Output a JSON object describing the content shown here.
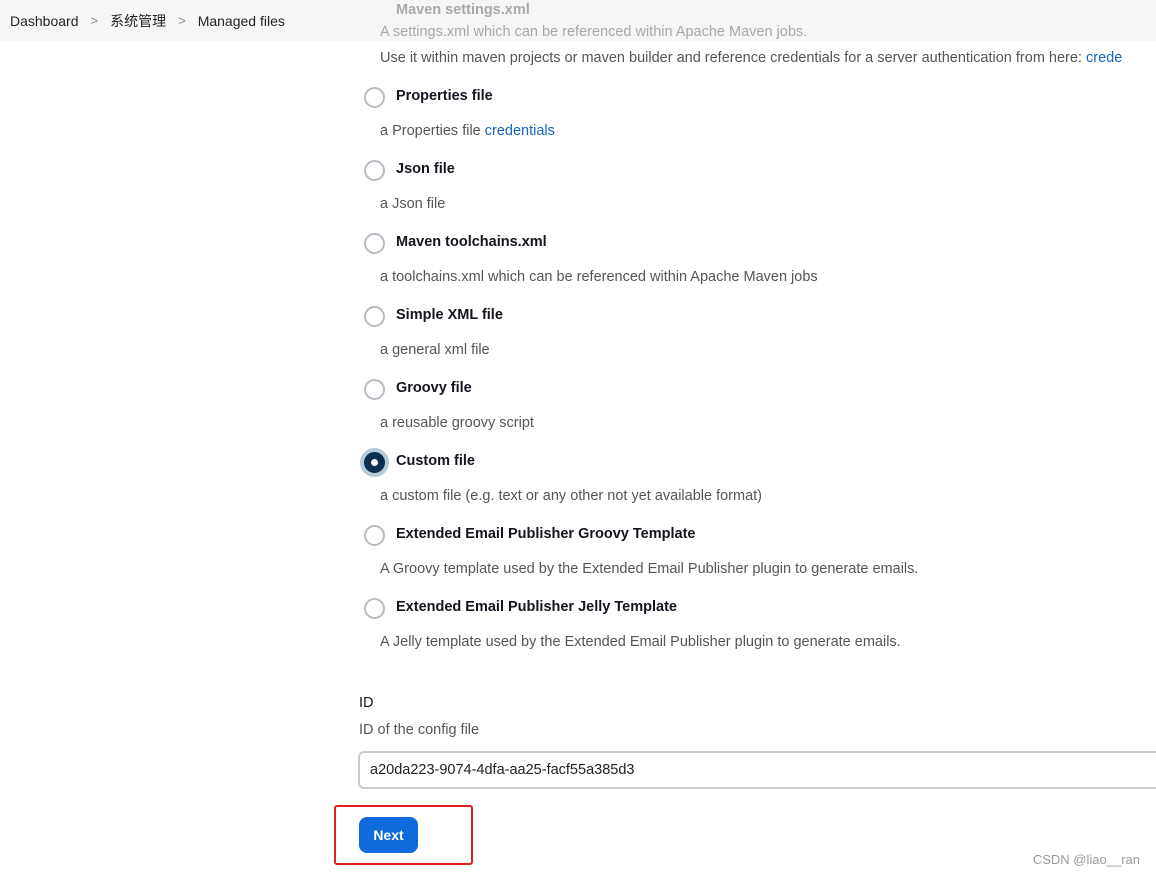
{
  "breadcrumb": [
    "Dashboard",
    "系统管理",
    "Managed files"
  ],
  "top_partial": {
    "label": "Maven settings.xml",
    "desc1": "A settings.xml which can be referenced within Apache Maven jobs.",
    "desc2": "Use it within maven projects or maven builder and reference credentials for a server authentication from here: ",
    "desc2_link": "crede"
  },
  "options": [
    {
      "label": "Properties file",
      "desc": "a Properties file ",
      "link": "credentials",
      "selected": false
    },
    {
      "label": "Json file",
      "desc": "a Json file",
      "selected": false
    },
    {
      "label": "Maven toolchains.xml",
      "desc": "a toolchains.xml which can be referenced within Apache Maven jobs",
      "selected": false
    },
    {
      "label": "Simple XML file",
      "desc": "a general xml file",
      "selected": false
    },
    {
      "label": "Groovy file",
      "desc": "a reusable groovy script",
      "selected": false
    },
    {
      "label": "Custom file",
      "desc": "a custom file (e.g. text or any other not yet available format)",
      "selected": true
    },
    {
      "label": "Extended Email Publisher Groovy Template",
      "desc": "A Groovy template used by the Extended Email Publisher plugin to generate emails.",
      "selected": false
    },
    {
      "label": "Extended Email Publisher Jelly Template",
      "desc": "A Jelly template used by the Extended Email Publisher plugin to generate emails.",
      "selected": false
    }
  ],
  "id_field": {
    "label": "ID",
    "help": "ID of the config file",
    "value": "a20da223-9074-4dfa-aa25-facf55a385d3"
  },
  "next_label": "Next",
  "watermark": "CSDN @liao__ran"
}
